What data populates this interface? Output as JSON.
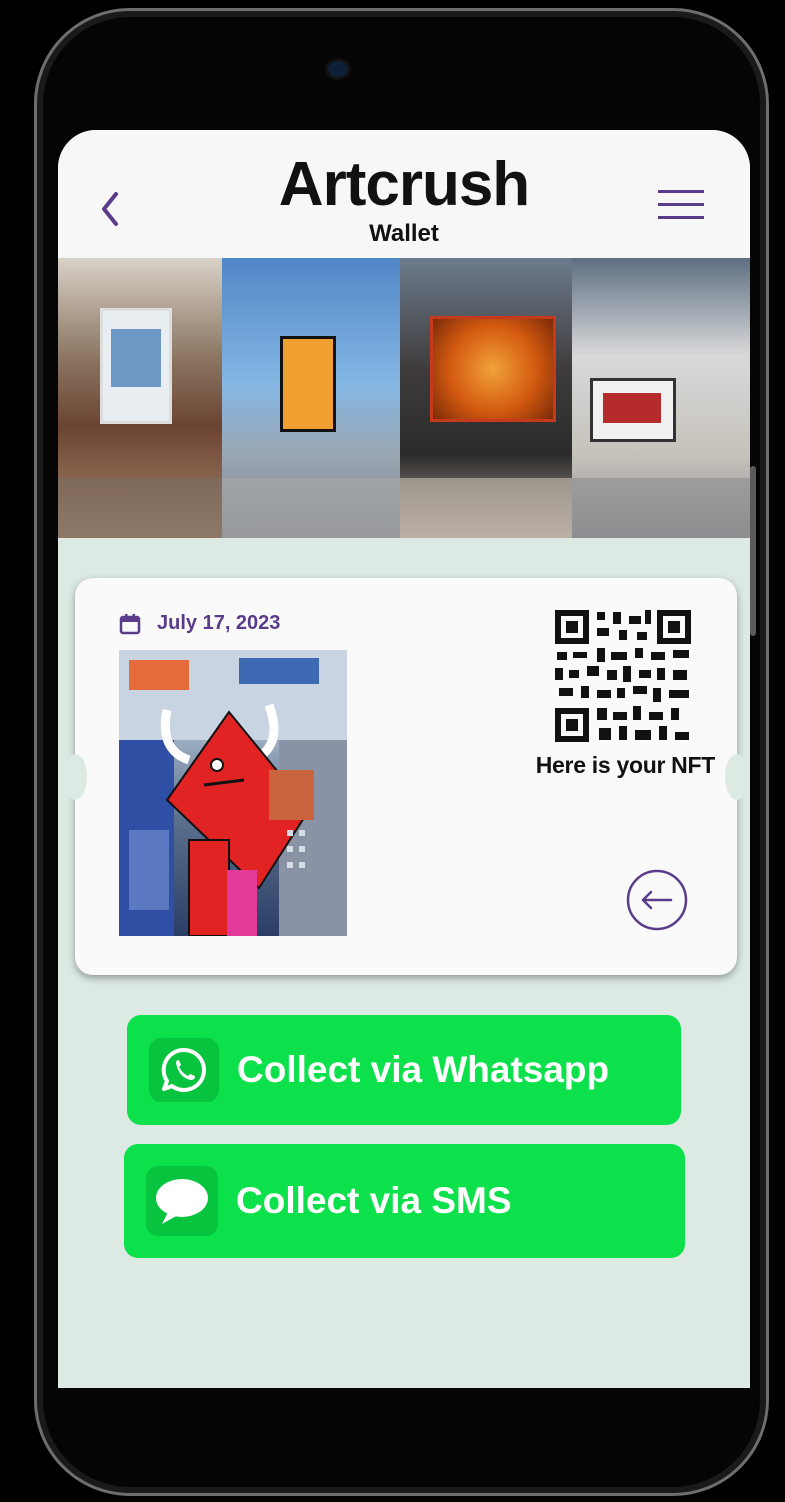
{
  "app": {
    "title": "Artcrush",
    "subtitle": "Wallet",
    "accent_color": "#5a3c8a",
    "button_color": "#0ce14c"
  },
  "header": {
    "back_icon": "chevron-left-icon",
    "menu_icon": "hamburger-menu-icon"
  },
  "ticket": {
    "date": "July 17, 2023",
    "date_icon": "calendar-icon",
    "qr_label": "Here is your NFT",
    "arrow_icon": "arrow-left-circle-icon"
  },
  "actions": {
    "whatsapp_label": "Collect via Whatsapp",
    "whatsapp_icon": "whatsapp-icon",
    "sms_label": "Collect via SMS",
    "sms_icon": "chat-bubble-icon"
  }
}
